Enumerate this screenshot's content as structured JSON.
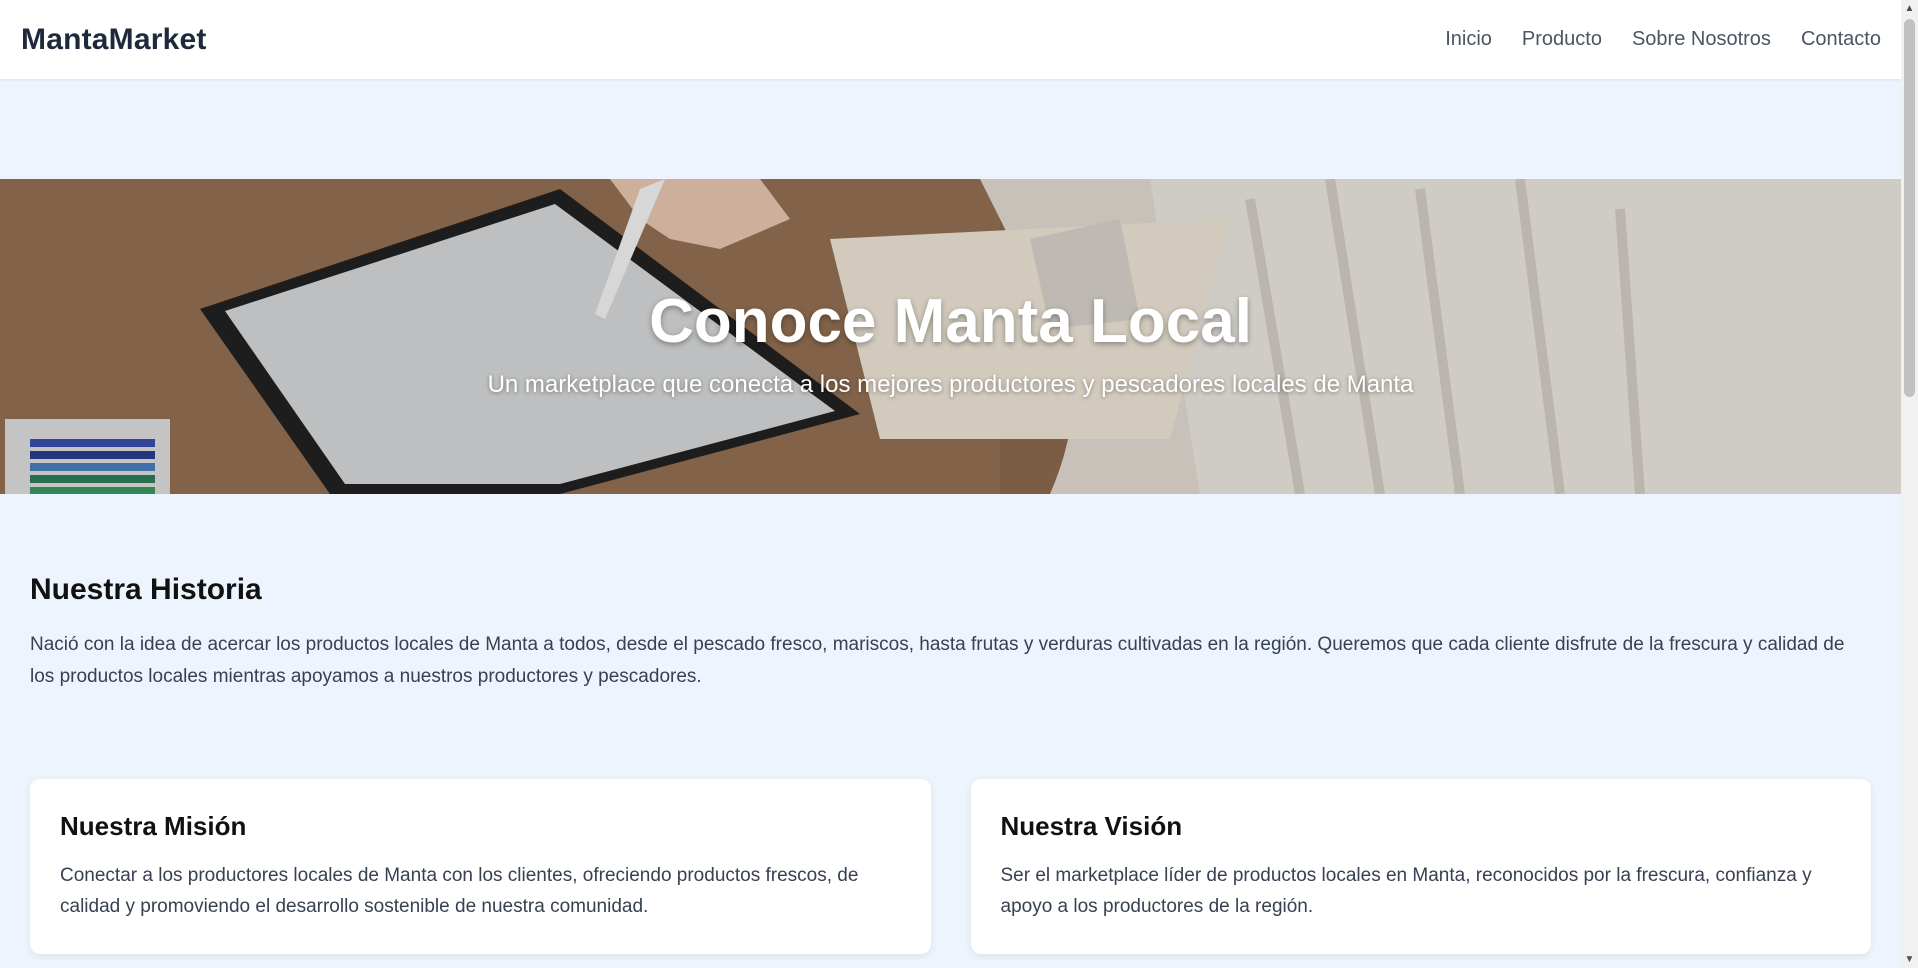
{
  "brand": "MantaMarket",
  "nav": {
    "items": [
      {
        "label": "Inicio"
      },
      {
        "label": "Producto"
      },
      {
        "label": "Sobre Nosotros"
      },
      {
        "label": "Contacto"
      }
    ]
  },
  "hero": {
    "title": "Conoce Manta Local",
    "subtitle": "Un marketplace que conecta a los mejores productores y pescadores locales de Manta"
  },
  "history": {
    "title": "Nuestra Historia",
    "text": "Nació con la idea de acercar los productos locales de Manta a todos, desde el pescado fresco, mariscos, hasta frutas y verduras cultivadas en la región. Queremos que cada cliente disfrute de la frescura y calidad de los productos locales mientras apoyamos a nuestros productores y pescadores."
  },
  "cards": [
    {
      "title": "Nuestra Misión",
      "text": "Conectar a los productores locales de Manta con los clientes, ofreciendo productos frescos, de calidad y promoviendo el desarrollo sostenible de nuestra comunidad."
    },
    {
      "title": "Nuestra Visión",
      "text": "Ser el marketplace líder de productos locales en Manta, reconocidos por la frescura, confianza y apoyo a los productores de la región."
    }
  ],
  "colors": {
    "page_background": "#eef4fd",
    "navbar_background": "#ffffff",
    "brand_text": "#1e2a3b",
    "card_background": "#ffffff"
  },
  "icons": {
    "scroll_up": "triangle-up-icon",
    "scroll_down": "triangle-down-icon"
  }
}
